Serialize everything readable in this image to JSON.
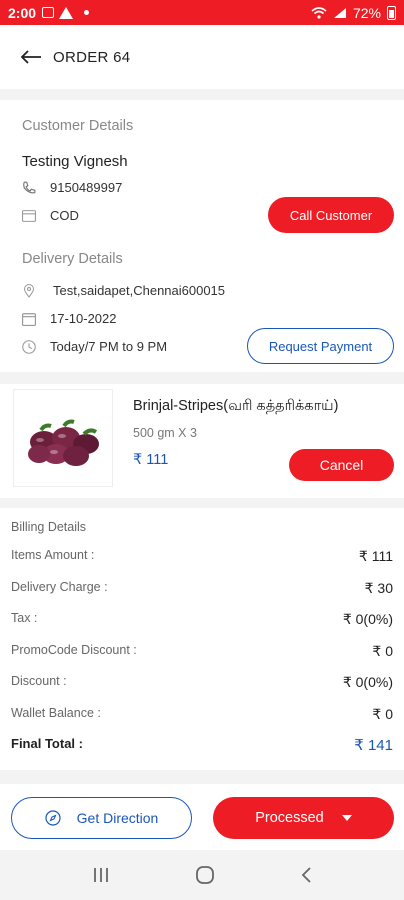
{
  "status_bar": {
    "time": "2:00",
    "battery": "72%"
  },
  "header": {
    "title": "ORDER 64"
  },
  "customer": {
    "section_title": "Customer Details",
    "name": "Testing Vignesh",
    "phone": "9150489997",
    "payment": "COD",
    "call_button": "Call Customer"
  },
  "delivery": {
    "section_title": "Delivery Details",
    "address": "Test,saidapet,Chennai600015",
    "date": "17-10-2022",
    "slot": "Today/7 PM to 9 PM",
    "request_button": "Request Payment"
  },
  "product": {
    "name": "Brinjal-Stripes(வரி கத்தரிக்காய்)",
    "quantity": "500 gm X 3",
    "price": "₹ 111",
    "cancel_button": "Cancel"
  },
  "billing": {
    "title": "Billing Details",
    "rows": [
      {
        "label": "Items Amount :",
        "value": "₹ 111"
      },
      {
        "label": "Delivery Charge :",
        "value": "₹ 30"
      },
      {
        "label": "Tax :",
        "value": "₹ 0(0%)"
      },
      {
        "label": "PromoCode Discount :",
        "value": "₹ 0"
      },
      {
        "label": "Discount :",
        "value": "₹ 0(0%)"
      },
      {
        "label": "Wallet Balance :",
        "value": "₹ 0"
      }
    ],
    "final_label": "Final Total :",
    "final_value": "₹ 141"
  },
  "actions": {
    "direction_button": "Get Direction",
    "status_button": "Processed"
  },
  "colors": {
    "accent": "#ee1c24",
    "link": "#1a56b8"
  }
}
